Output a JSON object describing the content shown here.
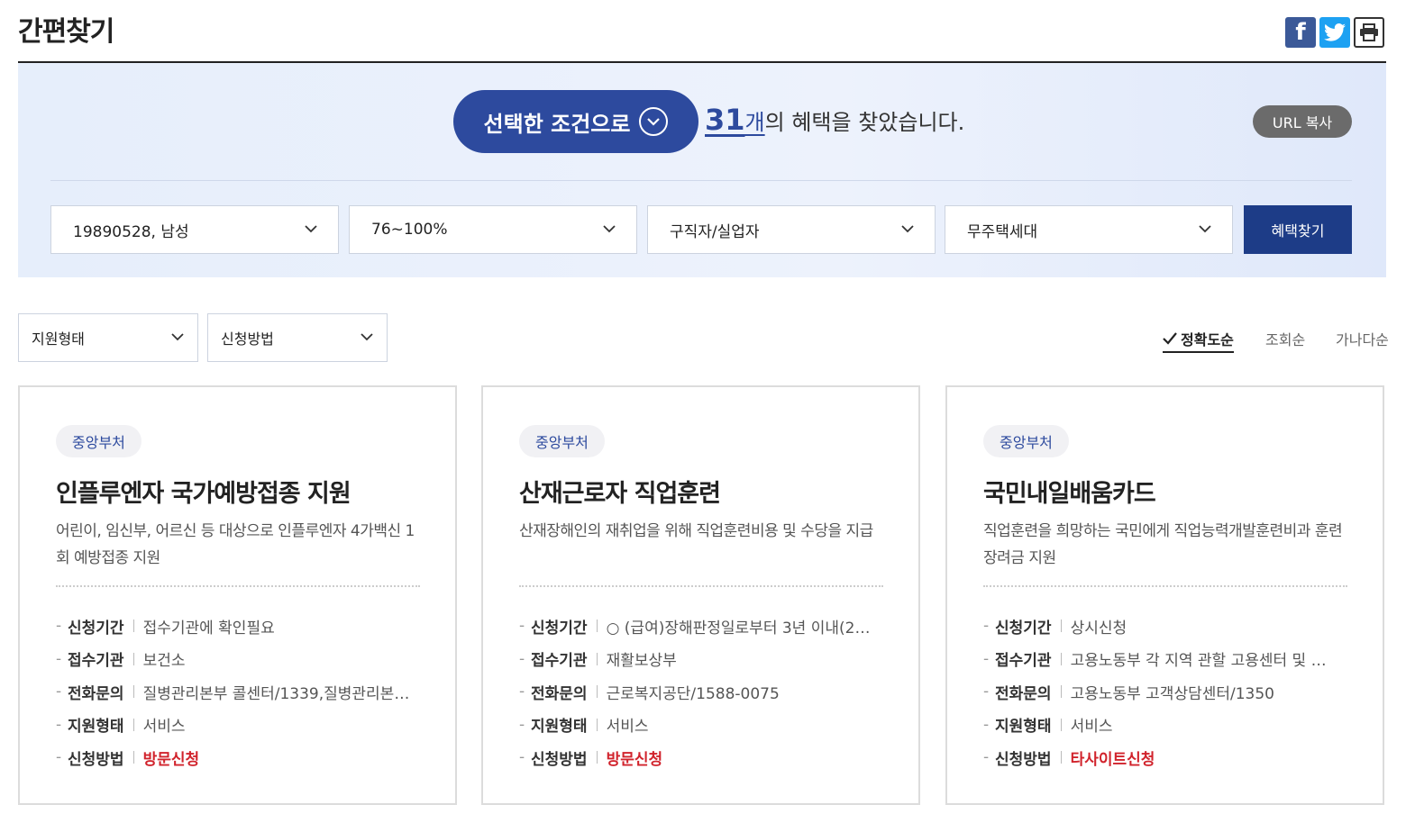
{
  "page": {
    "title": "간편찾기"
  },
  "share": {
    "facebook": "facebook-icon",
    "twitter": "twitter-icon",
    "print": "print-icon"
  },
  "hero": {
    "condition_button": "선택한 조건으로",
    "result_count": "31",
    "result_unit": "개",
    "result_suffix": "의 혜택을 찾았습니다.",
    "url_copy": "URL 복사",
    "filters": [
      "19890528, 남성",
      "76~100%",
      "구직자/실업자",
      "무주택세대"
    ],
    "search_button": "혜택찾기"
  },
  "list_filters": {
    "support_type": "지원형태",
    "apply_method": "신청방법"
  },
  "sort": {
    "options": [
      "정확도순",
      "조회순",
      "가나다순"
    ],
    "active": "정확도순"
  },
  "colors": {
    "primary": "#2d4a9e",
    "navy": "#1d3c87",
    "highlight": "#d1232c"
  },
  "cards": [
    {
      "badge": "중앙부처",
      "title": "인플루엔자 국가예방접종 지원",
      "desc": "어린이, 임신부, 어르신 등 대상으로 인플루엔자 4가백신 1회 예방접종 지원",
      "rows": [
        {
          "k": "신청기간",
          "v": "접수기관에 확인필요"
        },
        {
          "k": "접수기관",
          "v": "보건소"
        },
        {
          "k": "전화문의",
          "v": "질병관리본부 콜센터/1339,질병관리본…"
        },
        {
          "k": "지원형태",
          "v": "서비스"
        },
        {
          "k": "신청방법",
          "v": "방문신청"
        }
      ]
    },
    {
      "badge": "중앙부처",
      "title": "산재근로자 직업훈련",
      "desc": "산재장해인의 재취업을 위해 직업훈련비용 및 수당을 지급",
      "rows": [
        {
          "k": "신청기간",
          "v": "○ (급여)장해판정일로부터 3년 이내(2…"
        },
        {
          "k": "접수기관",
          "v": "재활보상부"
        },
        {
          "k": "전화문의",
          "v": "근로복지공단/1588-0075"
        },
        {
          "k": "지원형태",
          "v": "서비스"
        },
        {
          "k": "신청방법",
          "v": "방문신청"
        }
      ]
    },
    {
      "badge": "중앙부처",
      "title": "국민내일배움카드",
      "desc": "직업훈련을 희망하는 국민에게 직업능력개발훈련비과 훈련장려금 지원",
      "rows": [
        {
          "k": "신청기간",
          "v": "상시신청"
        },
        {
          "k": "접수기관",
          "v": "고용노동부 각 지역 관할 고용센터 및 …"
        },
        {
          "k": "전화문의",
          "v": "고용노동부 고객상담센터/1350"
        },
        {
          "k": "지원형태",
          "v": "서비스"
        },
        {
          "k": "신청방법",
          "v": "타사이트신청"
        }
      ]
    }
  ]
}
